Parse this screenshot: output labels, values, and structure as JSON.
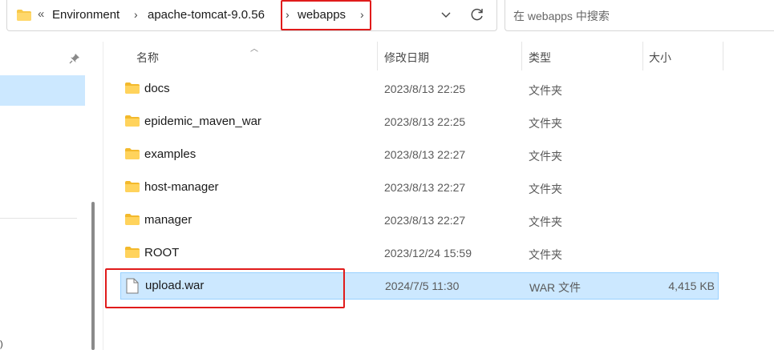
{
  "breadcrumb": {
    "overflow": "«",
    "items": [
      {
        "label": "Environment"
      },
      {
        "label": "apache-tomcat-9.0.56"
      },
      {
        "label": "webapps"
      }
    ]
  },
  "search": {
    "placeholder": "在 webapps 中搜索"
  },
  "columns": {
    "name": "名称",
    "modified": "修改日期",
    "type": "类型",
    "size": "大小"
  },
  "nav": {
    "fragment": ")"
  },
  "files": [
    {
      "name": "docs",
      "modified": "2023/8/13 22:25",
      "type": "文件夹",
      "size": "",
      "icon": "folder-icon"
    },
    {
      "name": "epidemic_maven_war",
      "modified": "2023/8/13 22:25",
      "type": "文件夹",
      "size": "",
      "icon": "folder-icon"
    },
    {
      "name": "examples",
      "modified": "2023/8/13 22:27",
      "type": "文件夹",
      "size": "",
      "icon": "folder-icon"
    },
    {
      "name": "host-manager",
      "modified": "2023/8/13 22:27",
      "type": "文件夹",
      "size": "",
      "icon": "folder-icon"
    },
    {
      "name": "manager",
      "modified": "2023/8/13 22:27",
      "type": "文件夹",
      "size": "",
      "icon": "folder-icon"
    },
    {
      "name": "ROOT",
      "modified": "2023/12/24 15:59",
      "type": "文件夹",
      "size": "",
      "icon": "folder-icon"
    },
    {
      "name": "upload.war",
      "modified": "2024/7/5 11:30",
      "type": "WAR 文件",
      "size": "4,415 KB",
      "icon": "file-icon",
      "selected": true
    }
  ],
  "colors": {
    "selection": "#cce8ff",
    "highlight": "#e01b1b",
    "folder": "#f8c94a"
  }
}
